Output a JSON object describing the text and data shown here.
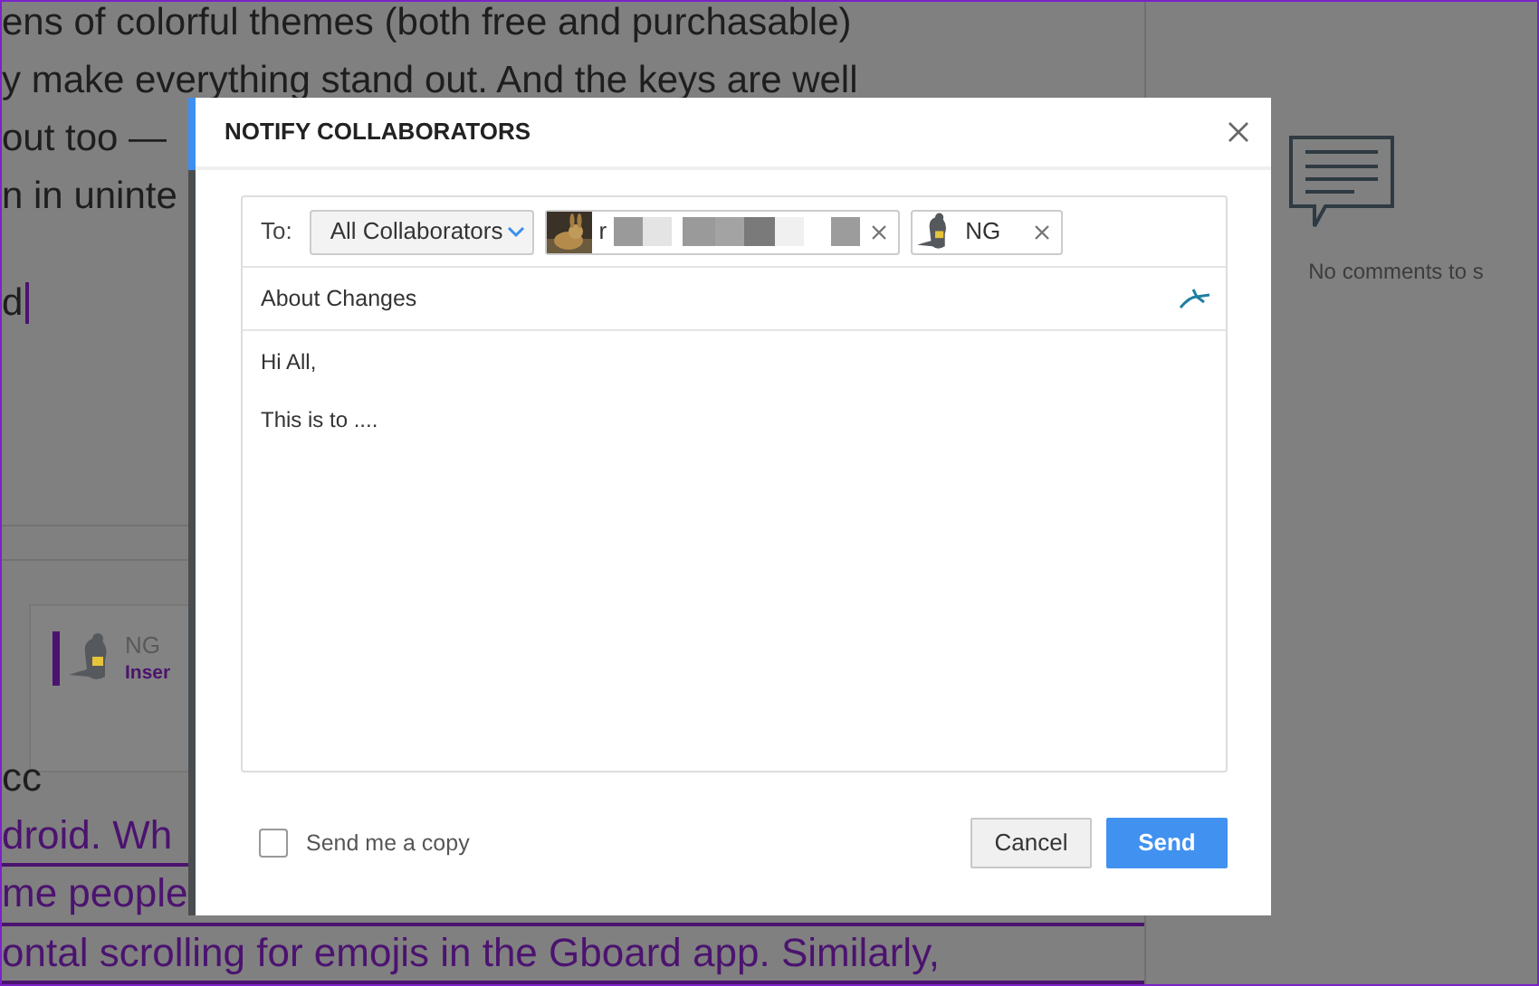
{
  "document": {
    "lines": [
      "ens of colorful themes (both free and purchasable)",
      "y make everything stand out. And the keys are well",
      "out too —",
      "n in uninte",
      "d"
    ],
    "comment_card": {
      "author": "NG",
      "action": "Inser"
    },
    "tracked_lines": [
      {
        "text": "cc",
        "inserted": false
      },
      {
        "text": "droid. Wh",
        "inserted": true
      },
      {
        "text": "me people",
        "inserted": true
      },
      {
        "text": "ontal scrolling for emojis in the Gboard app. Similarly,",
        "inserted": true
      }
    ]
  },
  "side_panel": {
    "empty_text": "No comments to s"
  },
  "dialog": {
    "title": "NOTIFY COLLABORATORS",
    "to_label": "To:",
    "recipient_group": "All Collaborators",
    "recipients": [
      {
        "name": "r",
        "kind": "picture",
        "redacted": true
      },
      {
        "name": "NG",
        "kind": "mouse",
        "redacted": false
      }
    ],
    "subject": "About Changes",
    "body": [
      "Hi All,",
      "This is to ...."
    ],
    "send_copy": {
      "label": "Send me a copy",
      "checked": false
    },
    "buttons": [
      {
        "label": "Cancel",
        "kind": "secondary"
      },
      {
        "label": "Send",
        "kind": "primary"
      }
    ]
  }
}
